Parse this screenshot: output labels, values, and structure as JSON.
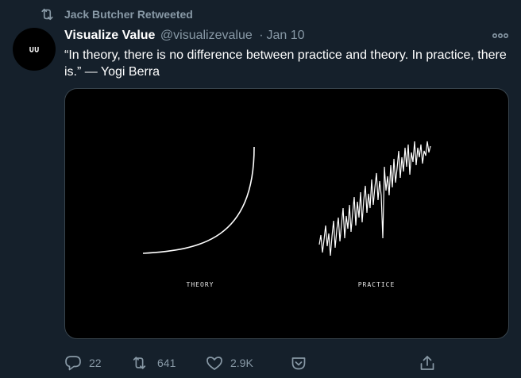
{
  "retweet": {
    "label": "Jack Butcher Retweeted",
    "icon": "retweet-icon"
  },
  "tweet": {
    "avatar_text": "VV",
    "author_name": "Visualize Value",
    "author_handle": "@visualizevalue",
    "separator": "·",
    "date": "Jan 10",
    "text": "“In theory, there is no difference between practice and theory. In practice, there is.” — Yogi Berra",
    "media": {
      "left_caption": "THEORY",
      "right_caption": "PRACTICE"
    }
  },
  "actions": {
    "reply_count": "22",
    "retweet_count": "641",
    "like_count": "2.9K",
    "icons": [
      "reply-icon",
      "retweet-icon",
      "like-icon",
      "save-icon",
      "share-icon"
    ]
  },
  "colors": {
    "background": "#15202b",
    "secondary_text": "#8899a6",
    "primary_text": "#ffffff",
    "border": "#38444d",
    "media_background": "#000000"
  }
}
